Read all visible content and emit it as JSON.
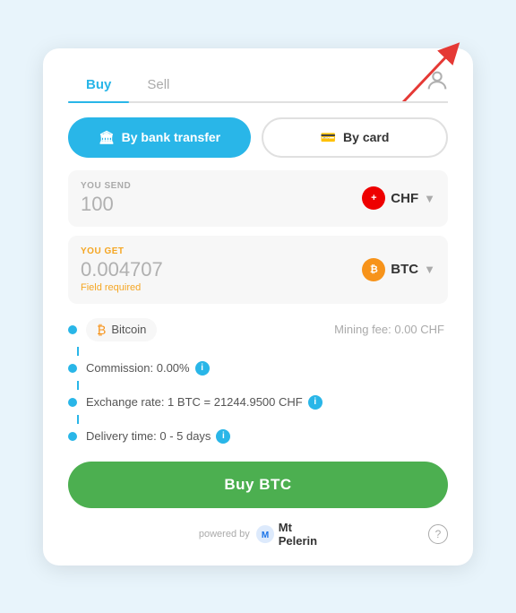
{
  "tabs": {
    "buy": "Buy",
    "sell": "Sell",
    "active": "buy"
  },
  "payment": {
    "bank_label": "By bank transfer",
    "card_label": "By card"
  },
  "send": {
    "label": "YOU SEND",
    "value": "100",
    "currency": "CHF",
    "currency_symbol": "+"
  },
  "receive": {
    "label": "YOU GET",
    "value": "0.004707",
    "field_required": "Field required",
    "currency": "BTC"
  },
  "bitcoin": {
    "name": "Bitcoin",
    "mining_fee": "Mining fee: 0.00 CHF"
  },
  "details": {
    "commission": "Commission: 0.00%",
    "exchange_rate": "Exchange rate: 1 BTC = 21244.9500 CHF",
    "delivery_time": "Delivery time: 0 - 5 days"
  },
  "buy_button": "Buy BTC",
  "footer": {
    "powered_by": "powered by",
    "brand": "Mt\nPelerin"
  },
  "icons": {
    "bank": "🏛",
    "card": "💳",
    "info": "i",
    "help": "?",
    "profile": "👤"
  }
}
